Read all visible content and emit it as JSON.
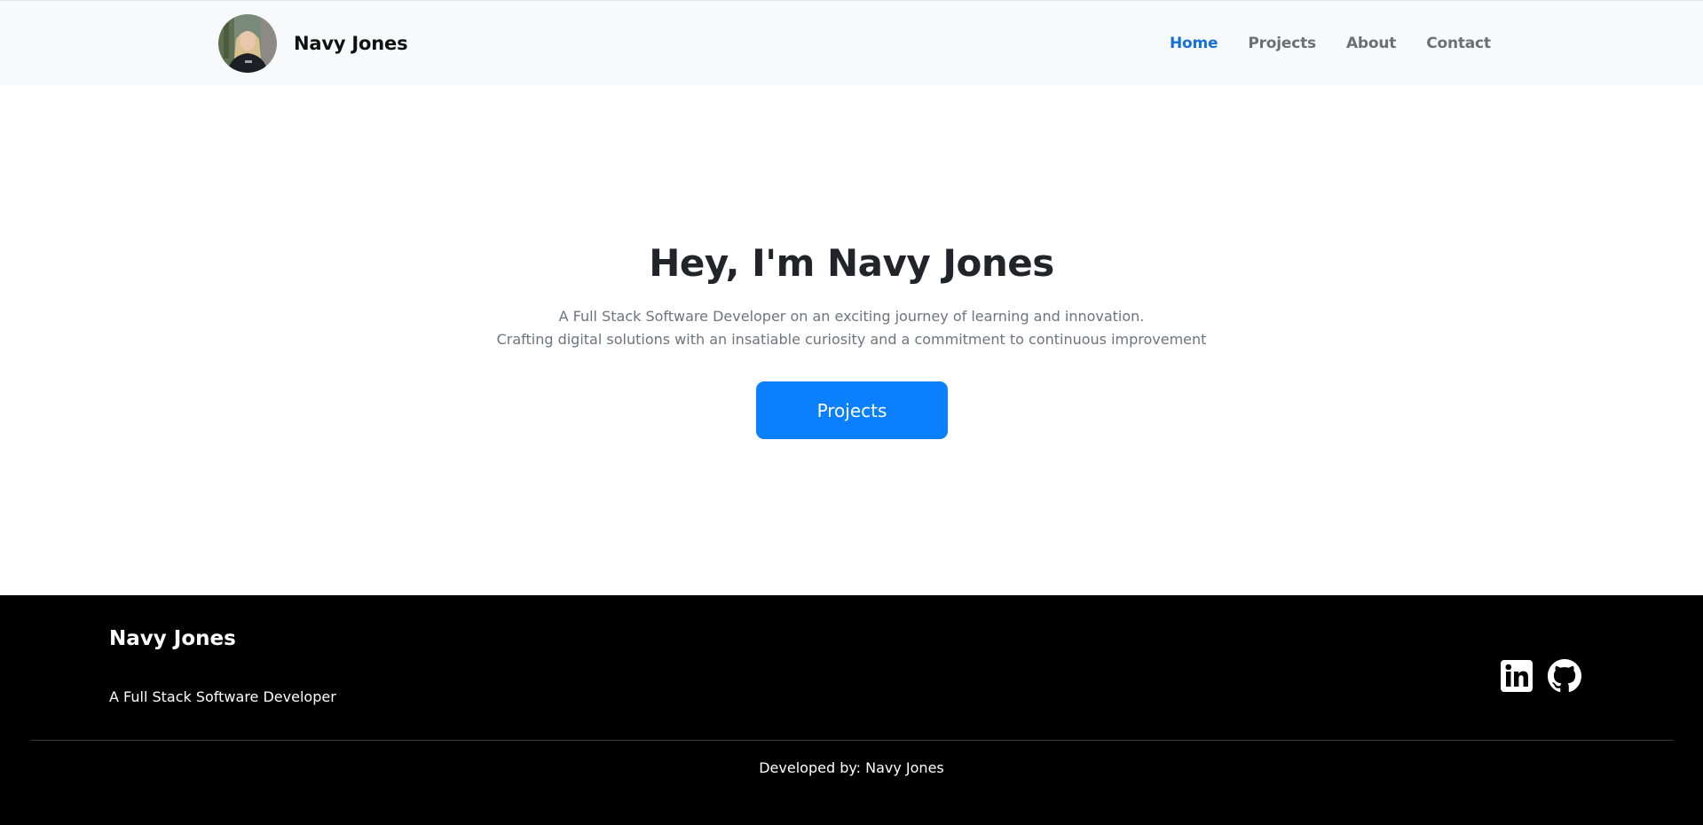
{
  "navbar": {
    "brand_name": "Navy Jones",
    "avatar_icon": "profile-photo",
    "links": [
      {
        "label": "Home",
        "active": true
      },
      {
        "label": "Projects",
        "active": false
      },
      {
        "label": "About",
        "active": false
      },
      {
        "label": "Contact",
        "active": false
      }
    ]
  },
  "hero": {
    "title": "Hey, I'm Navy Jones",
    "subtitle_line1": "A Full Stack Software Developer on an exciting journey of learning and innovation.",
    "subtitle_line2": "Crafting digital solutions with an insatiable curiosity and a commitment to continuous improvement",
    "button_label": "Projects"
  },
  "footer": {
    "name": "Navy Jones",
    "tagline": "A Full Stack Software Developer",
    "social_icons": [
      "linkedin-icon",
      "github-icon"
    ],
    "credit": "Developed by: Navy Jones"
  },
  "colors": {
    "nav_active": "#1270d8",
    "nav_inactive": "#6c6f73",
    "primary_button": "#0a80ff",
    "footer_bg": "#000000",
    "navbar_bg": "#f8f9fa"
  }
}
